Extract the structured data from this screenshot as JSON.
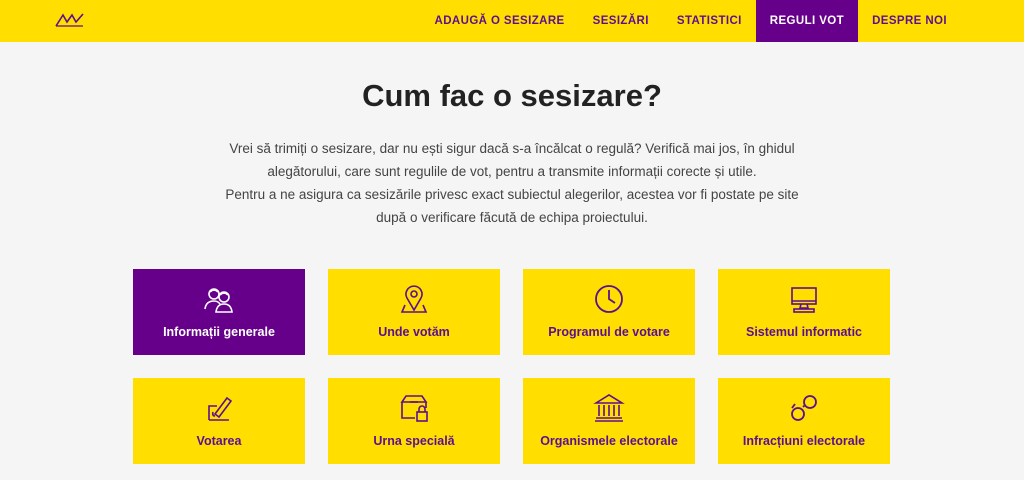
{
  "header": {
    "logo_icon": "mv-logo-icon",
    "nav": [
      {
        "label": "ADAUGĂ O SESIZARE"
      },
      {
        "label": "SESIZĂRI"
      },
      {
        "label": "STATISTICI"
      },
      {
        "label": "REGULI VOT",
        "active": true
      },
      {
        "label": "DESPRE NOI"
      }
    ]
  },
  "main": {
    "title": "Cum fac o sesizare?",
    "intro_lines": [
      "Vrei să trimiți o sesizare, dar nu ești sigur dacă s-a încălcat o regulă? Verifică mai jos, în ghidul",
      "alegătorului, care sunt regulile de vot, pentru a transmite informații corecte și utile.",
      "Pentru a ne asigura ca sesizările privesc exact subiectul alegerilor, acestea vor fi postate pe site",
      "după o verificare făcută de echipa proiectului."
    ],
    "cards": [
      {
        "label": "Informații generale",
        "icon": "people-icon",
        "active": true
      },
      {
        "label": "Unde votăm",
        "icon": "map-pin-icon"
      },
      {
        "label": "Programul de votare",
        "icon": "clock-icon"
      },
      {
        "label": "Sistemul informatic",
        "icon": "computer-icon"
      },
      {
        "label": "Votarea",
        "icon": "ballot-stamp-icon"
      },
      {
        "label": "Urna specială",
        "icon": "ballot-box-lock-icon"
      },
      {
        "label": "Organismele electorale",
        "icon": "institution-icon"
      },
      {
        "label": "Infracțiuni electorale",
        "icon": "handcuffs-icon"
      }
    ]
  },
  "colors": {
    "yellow": "#ffde00",
    "purple": "#66008a",
    "purple_text": "#5b0f91"
  }
}
